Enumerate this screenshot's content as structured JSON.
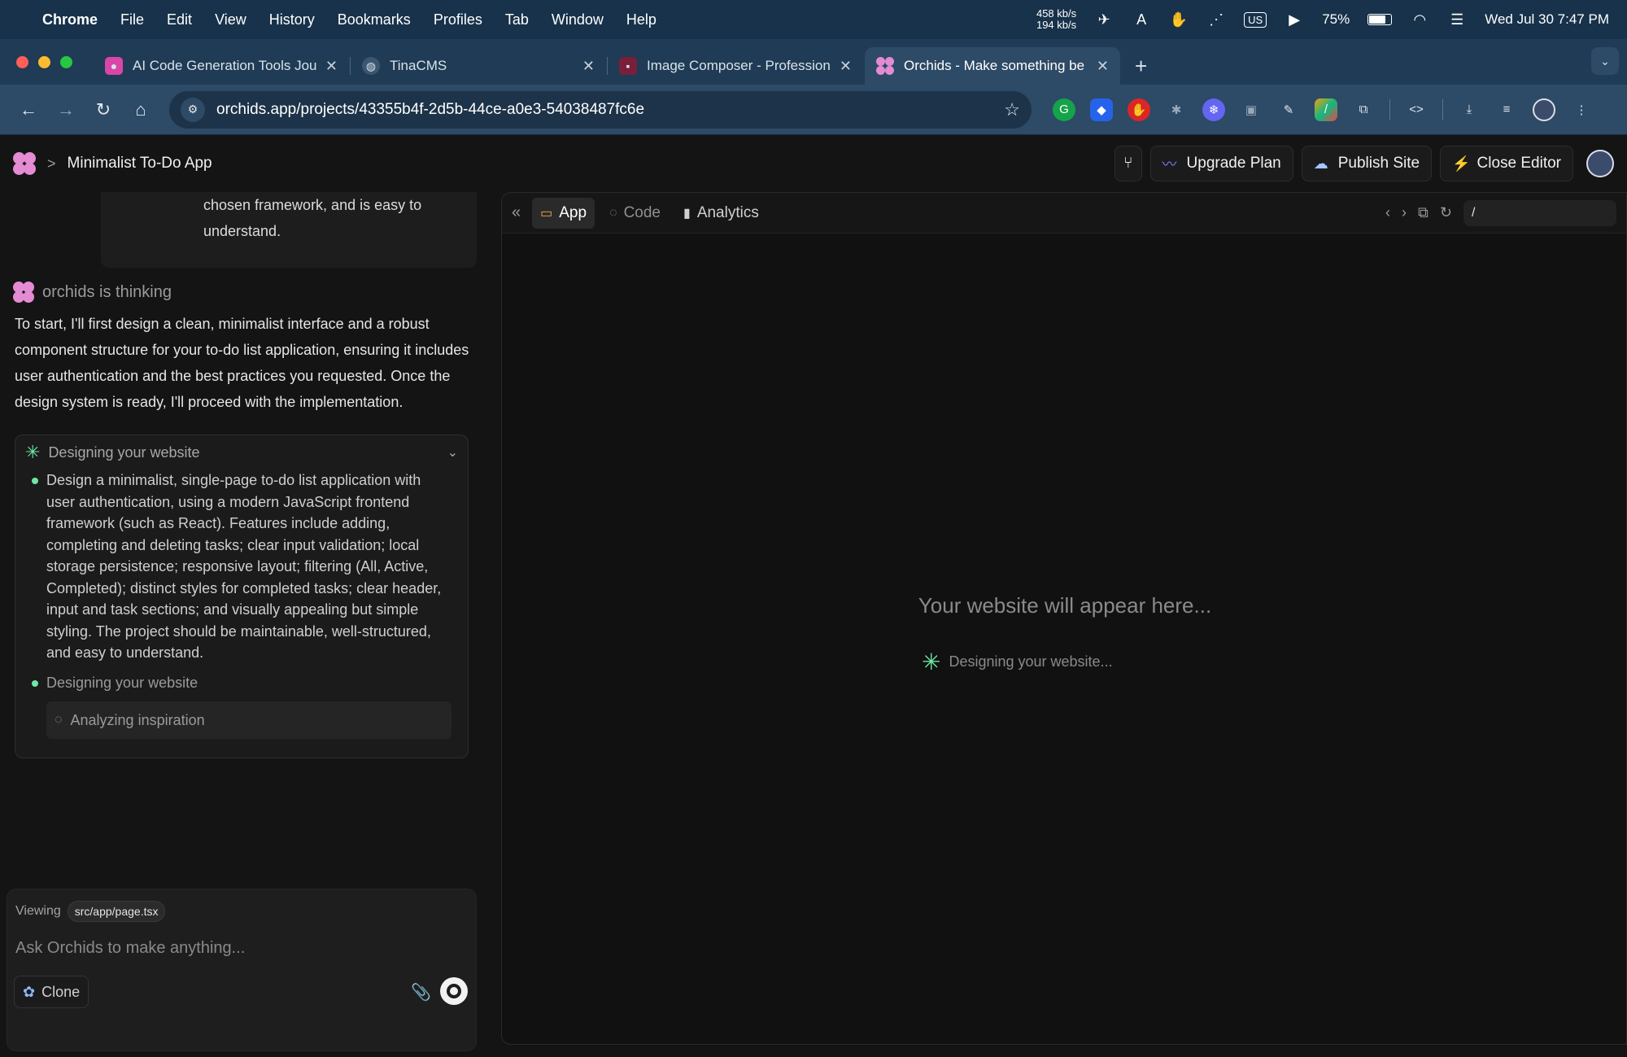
{
  "menubar": {
    "app": "Chrome",
    "items": [
      "File",
      "Edit",
      "View",
      "History",
      "Bookmarks",
      "Profiles",
      "Tab",
      "Window",
      "Help"
    ],
    "net_up": "458 kb/s",
    "net_down": "194 kb/s",
    "keyboard": "US",
    "battery": "75%",
    "battery_level": 0.75,
    "datetime": "Wed Jul 30  7:47 PM"
  },
  "tabs": [
    {
      "label": "AI Code Generation Tools Jou",
      "icon": "chat-icon",
      "color": "#d946a8"
    },
    {
      "label": "TinaCMS",
      "icon": "globe-icon",
      "color": "#6b7c8c"
    },
    {
      "label": "Image Composer - Profession",
      "icon": "composer-icon",
      "color": "#7a1f3a"
    },
    {
      "label": "Orchids - Make something be",
      "icon": "orchids-icon",
      "color": "#e58bd4"
    }
  ],
  "address": {
    "url": "orchids.app/projects/43355b4f-2d5b-44ce-a0e3-54038487fc6e"
  },
  "app": {
    "breadcrumb_sep": ">",
    "project": "Minimalist To-Do App",
    "upgrade": "Upgrade Plan",
    "publish": "Publish Site",
    "close": "Close Editor"
  },
  "chat": {
    "prev_message": "chosen framework, and is easy to understand.",
    "thinking": "orchids is thinking",
    "assistant_text": "To start, I'll first design a clean, minimalist interface and a robust component structure for your to-do list application, ensuring it includes user authentication and the best practices you requested. Once the design system is ready, I'll proceed with the implementation.",
    "card": {
      "title": "Designing your website",
      "items": [
        "Design a minimalist, single-page to-do list application with user authentication, using a modern JavaScript frontend framework (such as React). Features include adding, completing and deleting tasks; clear input validation; local storage persistence; responsive layout; filtering (All, Active, Completed); distinct styles for completed tasks; clear header, input and task sections; and visually appealing but simple styling. The project should be maintainable, well-structured, and easy to understand.",
        "Designing your website"
      ],
      "substep": "Analyzing inspiration"
    },
    "composer": {
      "viewing_label": "Viewing",
      "file": "src/app/page.tsx",
      "placeholder": "Ask Orchids to make anything...",
      "clone": "Clone"
    }
  },
  "preview": {
    "tabs": [
      "App",
      "Code",
      "Analytics"
    ],
    "path": "/",
    "placeholder": "Your website will appear here...",
    "status": "Designing your website..."
  },
  "colors": {
    "accent_green": "#6ee7a4",
    "orchid_pink": "#e58bd4",
    "menubar": "#17324a"
  }
}
